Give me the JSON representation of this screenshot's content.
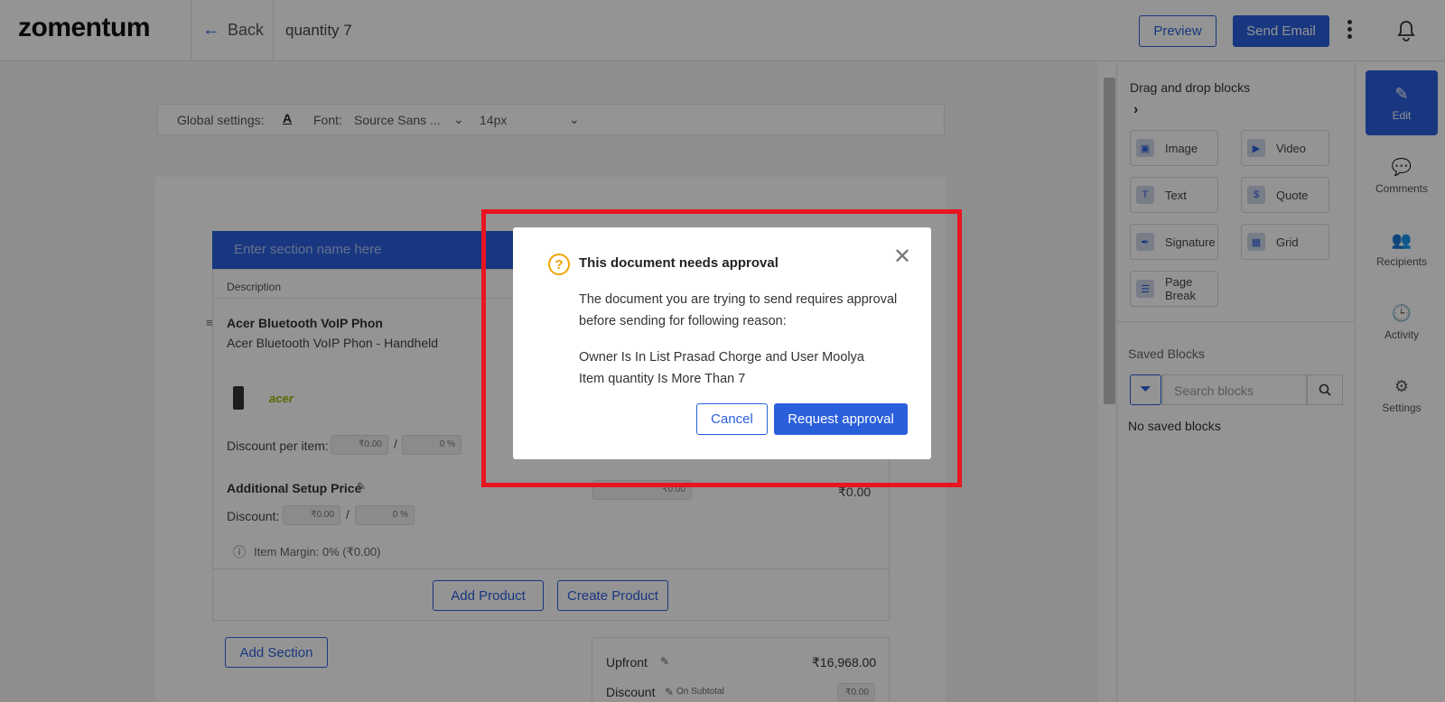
{
  "header": {
    "logo": "zomentum",
    "back_label": "Back",
    "doc_title": "quantity 7",
    "preview_label": "Preview",
    "send_email_label": "Send Email"
  },
  "toolbar": {
    "global_settings_label": "Global settings:",
    "font_icon": "A",
    "font_label": "Font:",
    "font_value": "Source Sans ...",
    "size_value": "14px"
  },
  "section": {
    "name_placeholder": "Enter section name here",
    "description_col": "Description",
    "product_title": "Acer Bluetooth VoIP Phon",
    "product_desc": "Acer Bluetooth VoIP Phon - Handheld",
    "brand": "acer",
    "discount_per_item_label": "Discount per item:",
    "discount_amount": "₹0.00",
    "discount_percent": "0 %",
    "setup_price_label": "Additional Setup Price",
    "discount_label": "Discount:",
    "setup_discount_amount": "₹0.00",
    "setup_discount_percent": "0 %",
    "setup_field_value": "₹0.00",
    "setup_total": "₹0.00",
    "item_margin": "Item Margin: 0% (₹0.00)",
    "add_product": "Add Product",
    "create_product": "Create Product",
    "add_section": "Add Section"
  },
  "summary": {
    "upfront_label": "Upfront",
    "upfront_value": "₹16,968.00",
    "discount_label": "Discount",
    "discount_note": "On Subtotal",
    "discount_value": "₹0.00"
  },
  "panel": {
    "heading": "Drag and drop blocks",
    "blocks": [
      "Image",
      "Video",
      "Text",
      "Quote",
      "Signature",
      "Grid",
      "Page Break"
    ],
    "saved_heading": "Saved Blocks",
    "search_placeholder": "Search blocks",
    "no_saved": "No saved blocks"
  },
  "rail": {
    "items": [
      "Edit",
      "Comments",
      "Recipients",
      "Activity",
      "Settings"
    ]
  },
  "dialog": {
    "title": "This document needs approval",
    "body": "The document you are trying to send requires approval before sending for following reason:",
    "reason_1": "Owner Is In List Prasad Chorge and User Moolya",
    "reason_2": "Item quantity Is More Than 7",
    "cancel_label": "Cancel",
    "request_label": "Request approval"
  },
  "colors": {
    "primary": "#2a5fdc",
    "highlight": "#e8141f",
    "warning": "#f0a500"
  }
}
